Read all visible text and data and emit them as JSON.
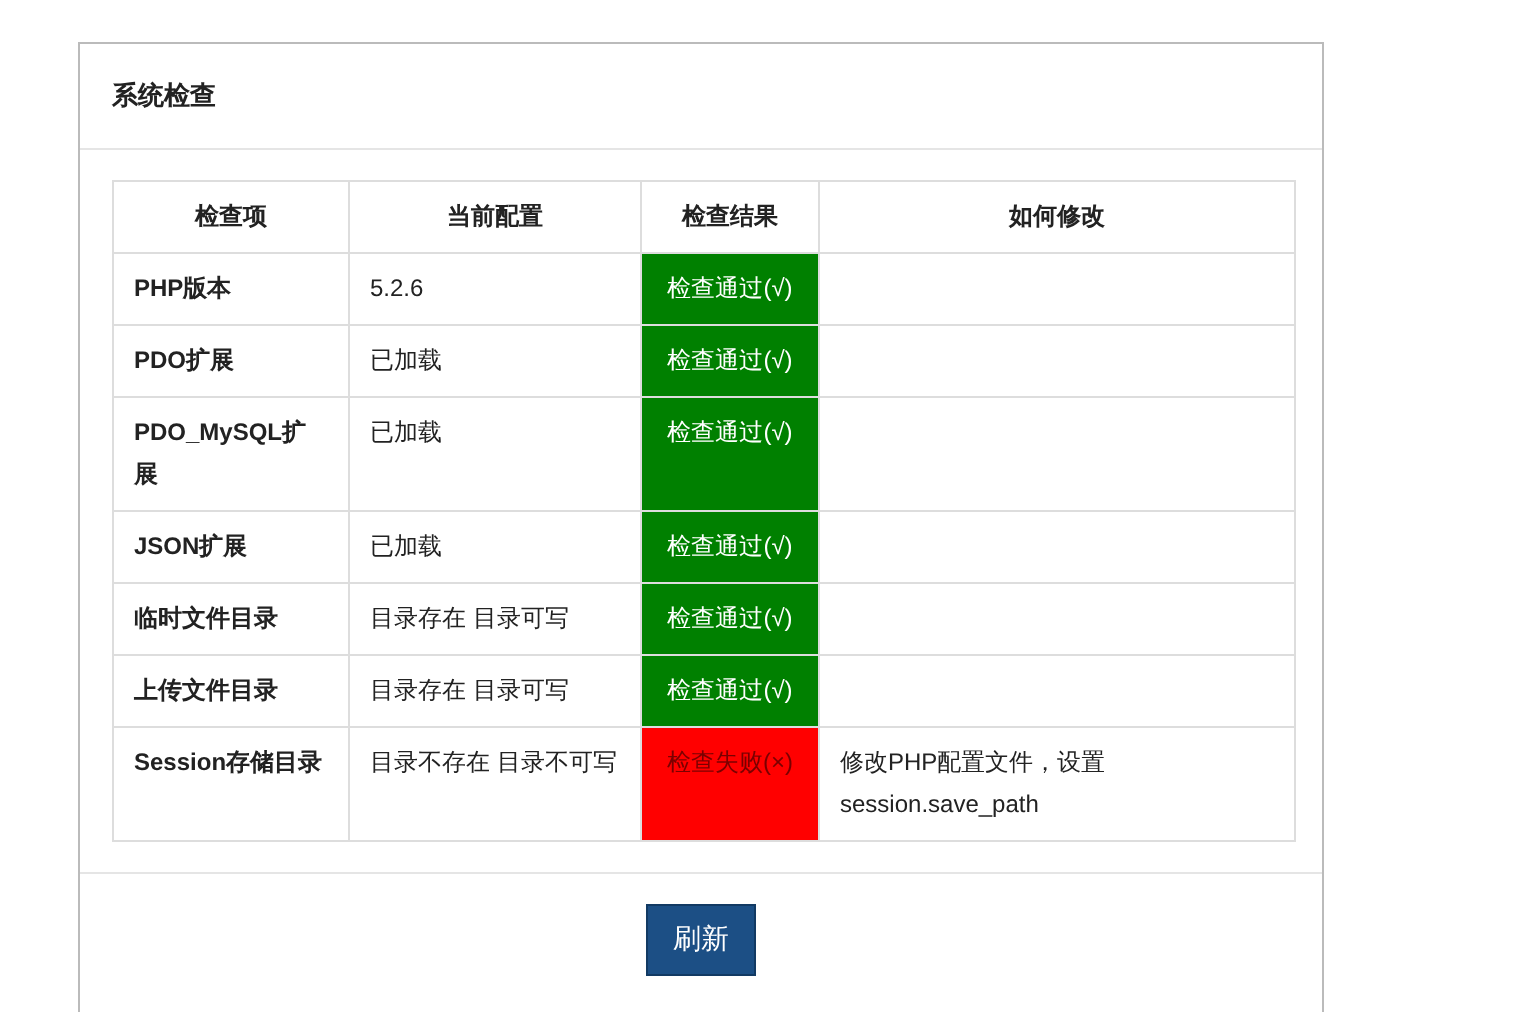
{
  "panel": {
    "title": "系统检查"
  },
  "table": {
    "columns": [
      "检查项",
      "当前配置",
      "检查结果",
      "如何修改"
    ],
    "rows": [
      {
        "item": "PHP版本",
        "config": "5.2.6",
        "result": "检查通过(√)",
        "passed": true
      },
      {
        "item": "PDO扩展",
        "config": "已加载",
        "result": "检查通过(√)",
        "passed": true
      },
      {
        "item": "PDO_MySQL扩展",
        "config": "已加载",
        "result": "检查通过(√)",
        "passed": true
      },
      {
        "item": "JSON扩展",
        "config": "已加载",
        "result": "检查通过(√)",
        "passed": true
      },
      {
        "item": "临时文件目录",
        "config": "目录存在 目录可写",
        "result": "检查通过(√)",
        "passed": true
      },
      {
        "item": "上传文件目录",
        "config": "目录存在 目录可写",
        "result": "检查通过(√)",
        "passed": true
      },
      {
        "item": "Session存储目录",
        "config": "目录不存在 目录不可写",
        "result": "检查失败(×)",
        "passed": false,
        "fix": "修改PHP配置文件，设置session.save_path"
      }
    ]
  },
  "button": "刷新"
}
